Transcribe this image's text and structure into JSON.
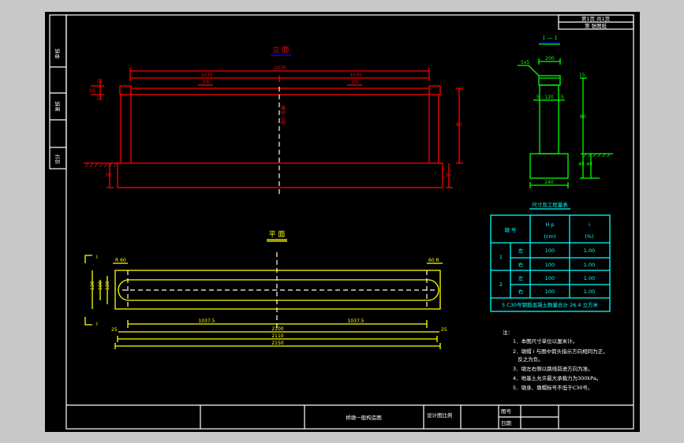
{
  "colors": {
    "elevation": "#ff0000",
    "plan": "#ffff00",
    "section": "#00ff00",
    "table": "#00ffff",
    "frame": "#ffffff",
    "background": "#000000"
  },
  "side_strip": {
    "labels": [
      "审核",
      "复核",
      "设计"
    ]
  },
  "top_right": {
    "row1": "第1页 共1页",
    "row2": "第 张图纸"
  },
  "elevation": {
    "title": "立 面",
    "dim_total": "2070",
    "dim_left": "1035",
    "dim_right": "1035",
    "slope_left": "1%",
    "slope_right": "1%",
    "center_label": "路中心线",
    "height": "80",
    "base_left": "30",
    "base_right": "30",
    "cap_dims": [
      "15",
      "20",
      "15"
    ]
  },
  "plan": {
    "title": "平 面",
    "section_mark": "I",
    "dim_left_top": "R 60",
    "dim_right_top": "60 R",
    "dim_half_left": "1037.5",
    "dim_half_right": "1037.5",
    "dim_row2": "2100",
    "dim_row2_end_left": "25",
    "dim_row2_end_right": "25",
    "dim_row3": "2110",
    "dim_row4": "2150",
    "width_dims": [
      "120",
      "100",
      "120"
    ]
  },
  "section": {
    "title": "I — I",
    "top_width": "200",
    "chamfer": "5x5",
    "mid_dims": [
      "5",
      "120",
      "5"
    ],
    "bottom_width": "240",
    "height": "80",
    "cap": "15",
    "footing_dims": [
      "40",
      "40"
    ]
  },
  "table": {
    "title": "尺寸及工程量表",
    "headers": {
      "no": "墩 号",
      "hp": "H p",
      "hp_unit": "(cm)",
      "i": "i",
      "i_unit": "(%)"
    },
    "groups": [
      {
        "no": "1",
        "rows": [
          {
            "side": "左",
            "hp": "100",
            "i": "1.00"
          },
          {
            "side": "右",
            "hp": "100",
            "i": "1.00"
          }
        ]
      },
      {
        "no": "2",
        "rows": [
          {
            "side": "左",
            "hp": "100",
            "i": "1.00"
          },
          {
            "side": "右",
            "hp": "100",
            "i": "1.00"
          }
        ]
      }
    ],
    "footer": "5  C30号钢筋混凝土数量合计 26.4 立方米"
  },
  "notes": {
    "heading": "注：",
    "items": [
      "1．本图尺寸单位以厘米计。",
      "2．墩帽 i 与图中箭头指示方向相同为正，",
      "   反之为负。",
      "3．墩左右侧以路线前进方向为准。",
      "4．地基土允许最大承载力为300kPa。",
      "5．墩身、墩帽标号不低于C30号。"
    ]
  },
  "title_block": {
    "drawing_name": "桥墩一般构造图",
    "scale_label": "设计图比例",
    "drawing_no_label": "图号",
    "date_label": "日期"
  }
}
